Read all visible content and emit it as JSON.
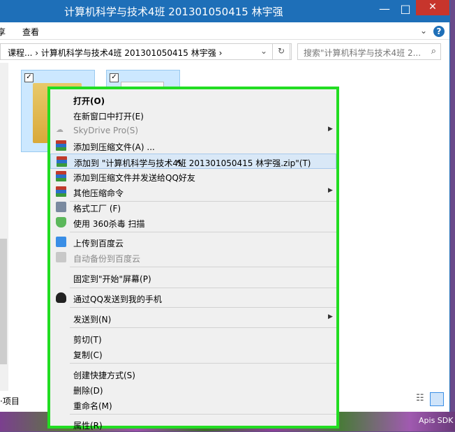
{
  "window": {
    "title": "计算机科学与技术4班 201301050415 林宇强",
    "minimize": "—",
    "maximize": "□",
    "close": "✕"
  },
  "ribbon": {
    "tab_left": "查看",
    "tab_cut": "享"
  },
  "address": {
    "path": "课程...  ›  计算机科学与技术4班 201301050415 林宇强  ›",
    "dropdown": "⌄",
    "refresh": "↻"
  },
  "search": {
    "placeholder": "搜索\"计算机科学与技术4班 2..."
  },
  "status": {
    "items_text": "·项目"
  },
  "watermark": "Apis SDK",
  "context_menu": {
    "items": [
      {
        "label": "打开(O)",
        "bold": true
      },
      {
        "label": "在新窗口中打开(E)"
      },
      {
        "label": "SkyDrive Pro(S)",
        "disabled": true,
        "submenu": true
      },
      {
        "label": "添加到压缩文件(A) ..."
      },
      {
        "label": "添加到 \"计算机科学与技术4班 201301050415 林宇强.zip\"(T)",
        "highlighted": true
      },
      {
        "label": "添加到压缩文件并发送给QQ好友"
      },
      {
        "label": "其他压缩命令",
        "submenu": true
      },
      {
        "label": "格式工厂 (F)"
      },
      {
        "label": "使用 360杀毒 扫描"
      },
      {
        "label": "上传到百度云"
      },
      {
        "label": "自动备份到百度云",
        "disabled": true
      },
      {
        "label": "固定到\"开始\"屏幕(P)"
      },
      {
        "label": "通过QQ发送到我的手机"
      },
      {
        "label": "发送到(N)",
        "submenu": true
      },
      {
        "label": "剪切(T)"
      },
      {
        "label": "复制(C)"
      },
      {
        "label": "创建快捷方式(S)"
      },
      {
        "label": "删除(D)"
      },
      {
        "label": "重命名(M)"
      },
      {
        "label": "属性(R)"
      }
    ],
    "submenu_arrow": "▶"
  }
}
